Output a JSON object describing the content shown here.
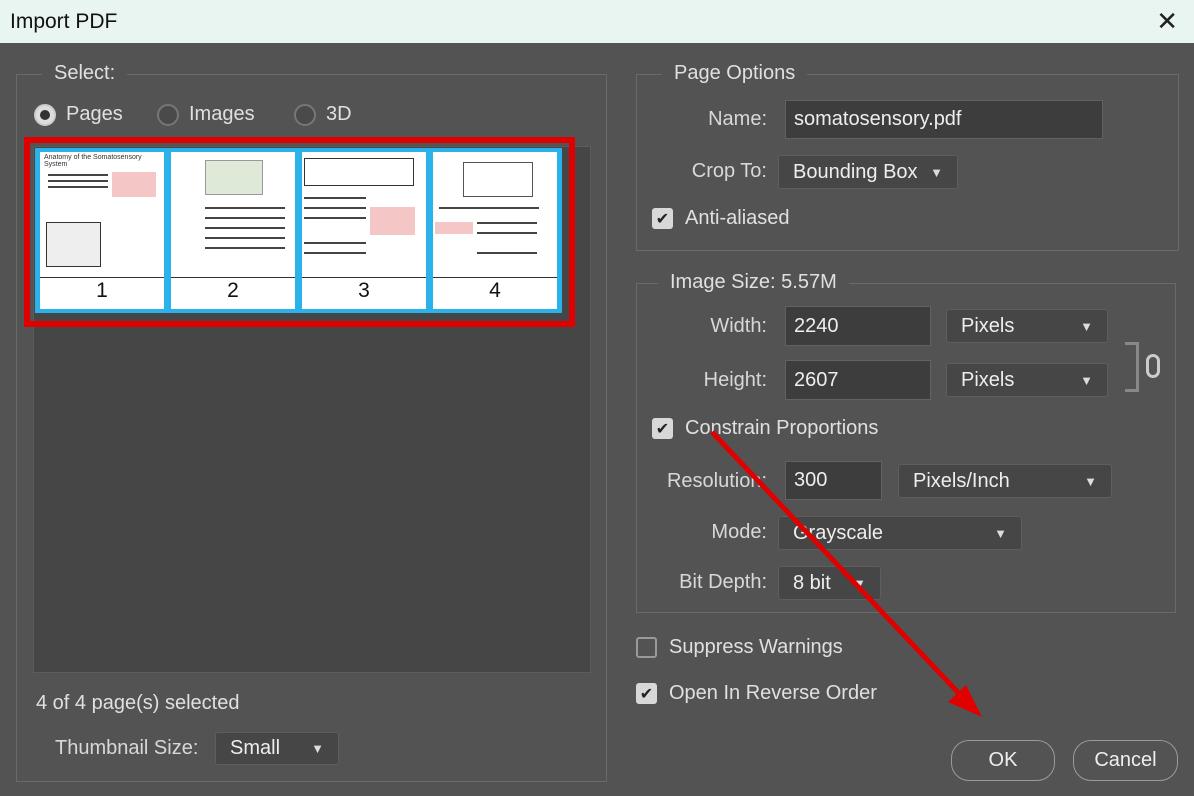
{
  "window": {
    "title": "Import PDF",
    "close_icon": "close-icon"
  },
  "select": {
    "legend": "Select:",
    "options": [
      {
        "label": "Pages",
        "selected": true
      },
      {
        "label": "Images",
        "selected": false
      },
      {
        "label": "3D",
        "selected": false
      }
    ],
    "thumbnails": [
      {
        "number": "1",
        "caption": "Anatomy of the Somatosensory System"
      },
      {
        "number": "2"
      },
      {
        "number": "3"
      },
      {
        "number": "4"
      }
    ],
    "status": "4 of 4 page(s) selected",
    "thumbnail_size_label": "Thumbnail Size:",
    "thumbnail_size": "Small"
  },
  "page_options": {
    "legend": "Page Options",
    "name_label": "Name:",
    "name_value": "somatosensory.pdf",
    "crop_label": "Crop To:",
    "crop_value": "Bounding Box",
    "anti_aliased_label": "Anti-aliased",
    "anti_aliased": true
  },
  "image_size": {
    "legend": "Image Size: 5.57M",
    "width_label": "Width:",
    "width_value": "2240",
    "width_unit": "Pixels",
    "height_label": "Height:",
    "height_value": "2607",
    "height_unit": "Pixels",
    "link_icon": "link-icon",
    "constrain_label": "Constrain Proportions",
    "constrain": true,
    "resolution_label": "Resolution:",
    "resolution_value": "300",
    "resolution_unit": "Pixels/Inch",
    "mode_label": "Mode:",
    "mode_value": "Grayscale",
    "bit_depth_label": "Bit Depth:",
    "bit_depth_value": "8 bit"
  },
  "suppress_warnings": {
    "label": "Suppress Warnings",
    "checked": false
  },
  "reverse_order": {
    "label": "Open In Reverse Order",
    "checked": true
  },
  "buttons": {
    "ok": "OK",
    "cancel": "Cancel"
  },
  "annotation_color": "#e00000",
  "selection_color": "#29b3ea"
}
